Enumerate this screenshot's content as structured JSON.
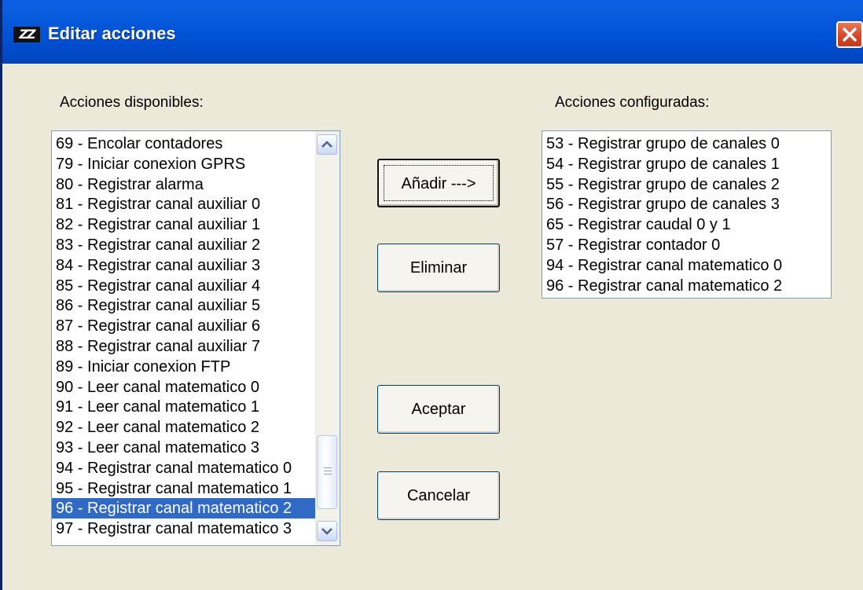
{
  "window": {
    "title": "Editar acciones",
    "icon": "app-logo-icon",
    "close_icon": "close-icon"
  },
  "available": {
    "label": "Acciones disponibles:",
    "items": [
      "69 - Encolar contadores",
      "79 - Iniciar conexion GPRS",
      "80 - Registrar alarma",
      "81 - Registrar canal auxiliar 0",
      "82 - Registrar canal auxiliar 1",
      "83 - Registrar canal auxiliar 2",
      "84 - Registrar canal auxiliar 3",
      "85 - Registrar canal auxiliar 4",
      "86 - Registrar canal auxiliar 5",
      "87 - Registrar canal auxiliar 6",
      "88 - Registrar canal auxiliar 7",
      "89 - Iniciar conexion FTP",
      "90 - Leer canal matematico 0",
      "91 - Leer canal matematico 1",
      "92 - Leer canal matematico 2",
      "93 - Leer canal matematico 3",
      "94 - Registrar canal matematico 0",
      "95 - Registrar canal matematico 1",
      "96 - Registrar canal matematico 2",
      "97 - Registrar canal matematico 3"
    ],
    "selected_index": 18
  },
  "configured": {
    "label": "Acciones configuradas:",
    "items": [
      "53 - Registrar grupo de canales 0",
      "54 - Registrar grupo de canales 1",
      "55 - Registrar grupo de canales 2",
      "56 - Registrar grupo de canales 3",
      "65 - Registrar caudal 0 y 1",
      "57 - Registrar contador 0",
      "94 - Registrar canal matematico 0",
      "96 - Registrar canal matematico 2"
    ]
  },
  "buttons": {
    "add": "Añadir --->",
    "remove": "Eliminar",
    "accept": "Aceptar",
    "cancel": "Cancelar"
  },
  "colors": {
    "titlebar": "#0153d6",
    "selection": "#316ac5",
    "dialog_bg": "#ece9d8"
  }
}
